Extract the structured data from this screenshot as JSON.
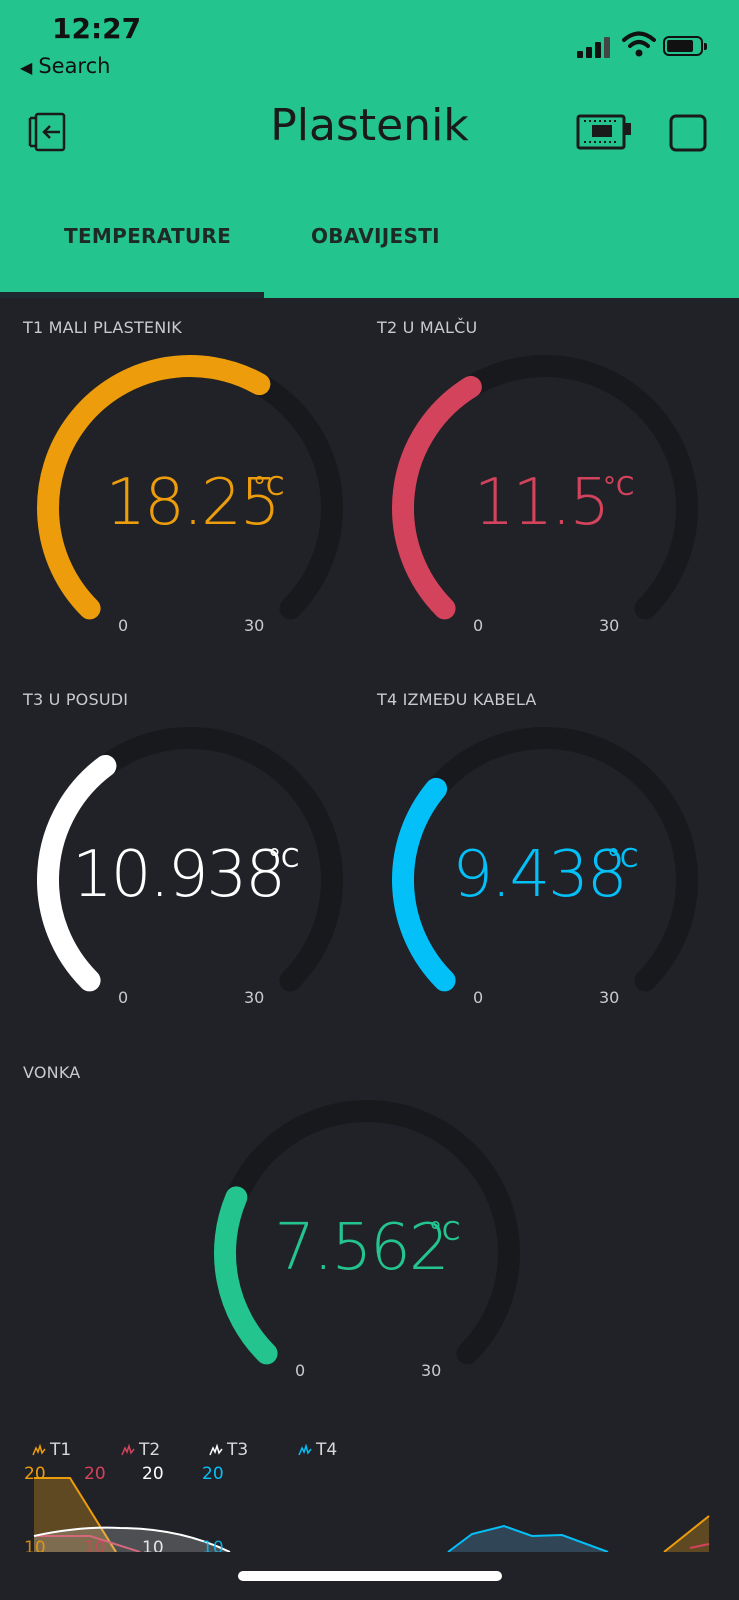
{
  "status_bar": {
    "time": "12:27",
    "back_label": "Search"
  },
  "app": {
    "title": "Plastenik"
  },
  "tabs": [
    {
      "label": "TEMPERATURE",
      "active": true
    },
    {
      "label": "OBAVIJESTI",
      "active": false
    }
  ],
  "gauges": [
    {
      "label": "T1 MALI PLASTENIK",
      "value": "18.25",
      "unit": "°C",
      "min": "0",
      "max": "30",
      "color": "#ed9d0b"
    },
    {
      "label": "T2 U MALČU",
      "value": "11.5",
      "unit": "°C",
      "min": "0",
      "max": "30",
      "color": "#d3435c"
    },
    {
      "label": "T3 U POSUDI",
      "value": "10.938",
      "unit": "°C",
      "min": "0",
      "max": "30",
      "color": "#ffffff"
    },
    {
      "label": "T4 IZMEĐU KABELA",
      "value": "9.438",
      "unit": "°C",
      "min": "0",
      "max": "30",
      "color": "#04c0f8"
    },
    {
      "label": "VONKA",
      "value": "7.562",
      "unit": "°C",
      "min": "0",
      "max": "30",
      "color": "#23c48e"
    }
  ],
  "chart_data": {
    "type": "line",
    "series": [
      {
        "name": "T1",
        "color": "#ed9d0b",
        "ytop": "20",
        "ymid": "10"
      },
      {
        "name": "T2",
        "color": "#d3435c",
        "ytop": "20",
        "ymid": "10"
      },
      {
        "name": "T3",
        "color": "#ffffff",
        "ytop": "20",
        "ymid": "10"
      },
      {
        "name": "T4",
        "color": "#04c0f8",
        "ytop": "20",
        "ymid": "10"
      }
    ]
  },
  "colors": {
    "header": "#23c48e",
    "background": "#212227",
    "track": "#18191d"
  }
}
